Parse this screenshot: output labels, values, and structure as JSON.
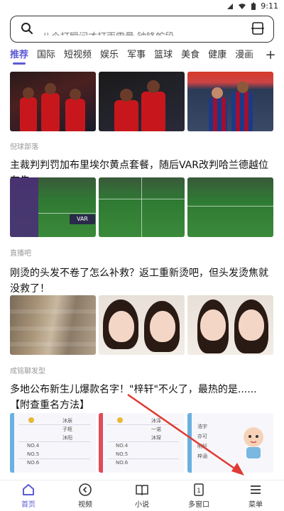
{
  "status": {
    "time": "9:11"
  },
  "search": {
    "text": "八个打瞬间才打雨雷量 钟锋蛇段"
  },
  "tabs": [
    "推荐",
    "国际",
    "短视频",
    "娱乐",
    "军事",
    "篮球",
    "美食",
    "健康",
    "漫画"
  ],
  "tab_add": "+",
  "feed": [
    {
      "source": "倪球部落",
      "title": "主裁判判罚加布里埃尔黄点套餐，随后VAR改判哈兰德越位在先"
    },
    {
      "source": "直播吧",
      "title": "刚烫的头发不卷了怎么补救？返工重新烫吧，但头发烫焦就没救了！"
    },
    {
      "source": "成铭聊发型",
      "title": "多地公布新生儿爆款名字！\"梓轩\"不火了，最热的是......【附查重名方法】"
    }
  ],
  "images": {
    "var_badge": "VAR",
    "doc_rows": [
      "沐辰",
      "子枢",
      "沐阳",
      "NO.4",
      "NO.5",
      "NO.6"
    ],
    "doc_rows2": [
      "沐泽",
      "一诺",
      "沐琛",
      "NO.4",
      "NO.5",
      "NO.6"
    ],
    "doc_names2": [
      "浩宇",
      "亦可",
      "明轩",
      "梓涵"
    ]
  },
  "bottom_nav": [
    {
      "label": "首页",
      "icon": "home-icon"
    },
    {
      "label": "视频",
      "icon": "video-icon"
    },
    {
      "label": "小说",
      "icon": "book-icon"
    },
    {
      "label": "多窗口",
      "icon": "window-icon",
      "badge": "1"
    },
    {
      "label": "菜单",
      "icon": "menu-icon"
    }
  ],
  "colors": {
    "accent": "#5b5bd6",
    "annotation": "#e03a32"
  }
}
